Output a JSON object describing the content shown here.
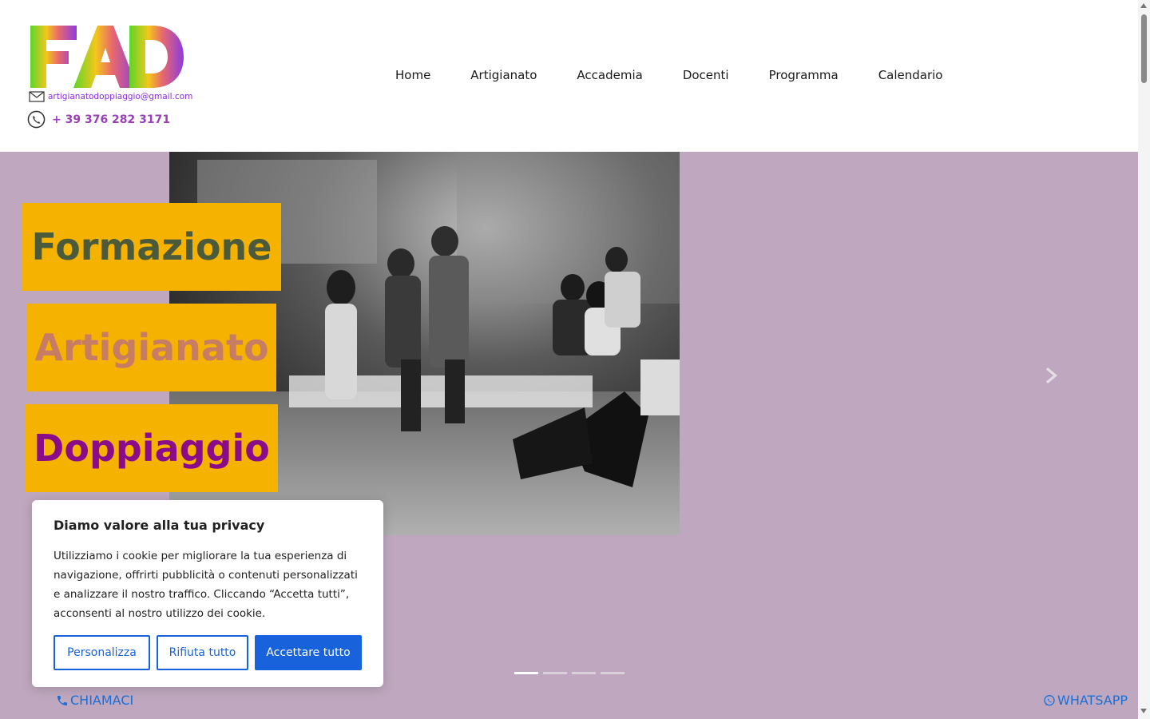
{
  "header": {
    "logo": {
      "letters": "FAD",
      "email": "artigianatodoppiaggio@gmail.com",
      "phone": "+ 39 376 282 3171"
    },
    "nav": [
      {
        "label": "Home"
      },
      {
        "label": "Artigianato"
      },
      {
        "label": "Accademia"
      },
      {
        "label": "Docenti"
      },
      {
        "label": "Programma"
      },
      {
        "label": "Calendario"
      }
    ]
  },
  "hero": {
    "labels": [
      "Formazione",
      "Artigianato",
      "Doppiaggio"
    ],
    "slide_count": 4,
    "active_slide": 1,
    "next_icon": "chevron-right-icon"
  },
  "contact": {
    "call_label": "CHIAMACI",
    "call_icon": "phone-icon",
    "whatsapp_label": "WHATSAPP",
    "whatsapp_icon": "whatsapp-icon"
  },
  "cookie_banner": {
    "title": "Diamo valore alla tua privacy",
    "text": "Utilizziamo i cookie per migliorare la tua esperienza di navigazione, offrirti pubblicità o contenuti personalizzati e analizzare il nostro traffico. Cliccando “Accetta tutti”, acconsenti al nostro utilizzo dei cookie.",
    "customize_label": "Personalizza",
    "reject_label": "Rifiuta tutto",
    "accept_label": "Accettare tutto"
  },
  "colors": {
    "hero_background": "#bfa8bf",
    "label_background": "#f5b300",
    "link_blue": "#1a6fd6",
    "cookie_accent": "#1863dc"
  }
}
